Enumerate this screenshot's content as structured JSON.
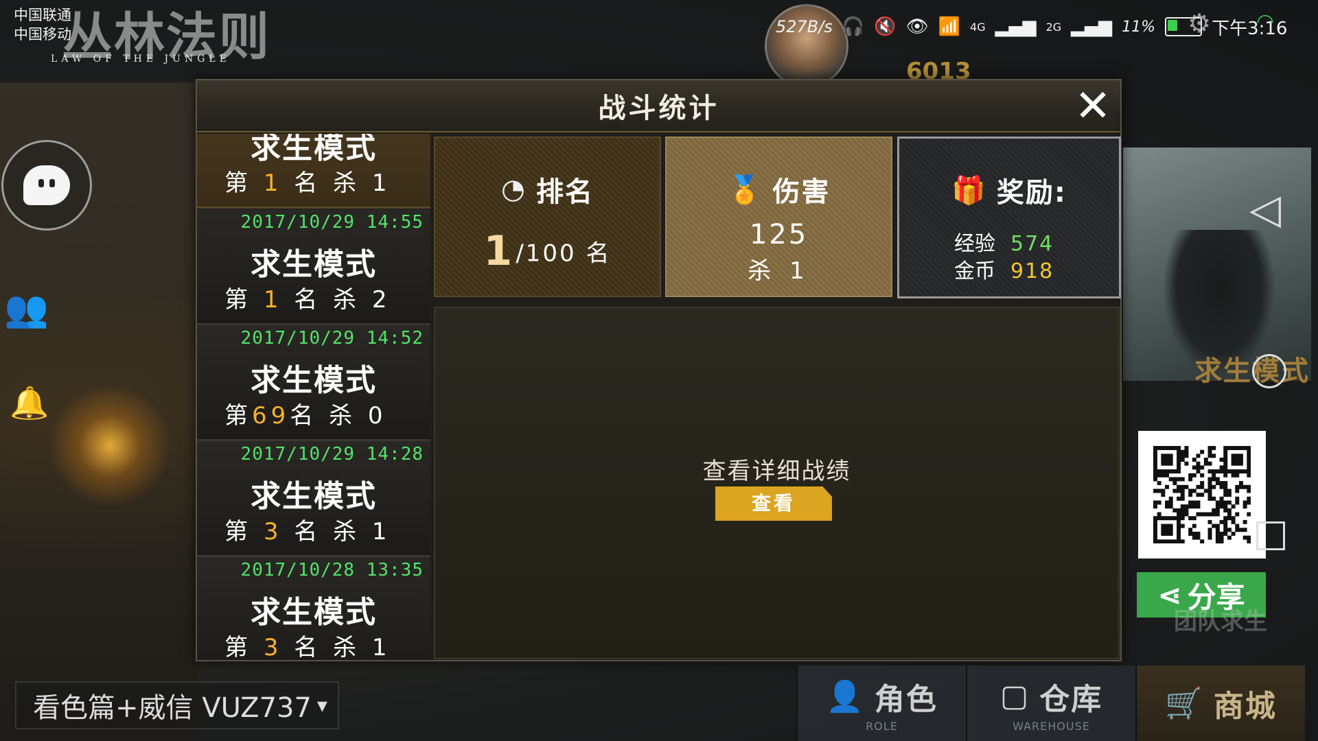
{
  "status": {
    "carrier_1": "中国联通",
    "carrier_2": "中国移动",
    "speed": "527B/s",
    "net1": "4G",
    "net2": "2G",
    "battery_pct": "11%",
    "time": "下午3:16"
  },
  "game": {
    "logo_title": "丛林法则",
    "logo_subtitle": "LAW OF THE JUNGLE",
    "gold_amount": "6013"
  },
  "modal": {
    "title": "战斗统计",
    "close_symbol": "✕"
  },
  "match_list": [
    {
      "date": "",
      "mode": "求生模式",
      "rank_prefix": "第",
      "rank": "1",
      "rank_suffix": "名",
      "kill_label": "杀",
      "kills": "1",
      "active": true
    },
    {
      "date": "2017/10/29 14:55",
      "mode": "求生模式",
      "rank_prefix": "第",
      "rank": "1",
      "rank_suffix": "名",
      "kill_label": "杀",
      "kills": "2",
      "active": false
    },
    {
      "date": "2017/10/29 14:52",
      "mode": "求生模式",
      "rank_prefix": "第",
      "rank": "69",
      "rank_suffix": "名",
      "kill_label": "杀",
      "kills": "0",
      "active": false
    },
    {
      "date": "2017/10/29 14:28",
      "mode": "求生模式",
      "rank_prefix": "第",
      "rank": "3",
      "rank_suffix": "名",
      "kill_label": "杀",
      "kills": "1",
      "active": false
    },
    {
      "date": "2017/10/28 13:35",
      "mode": "求生模式",
      "rank_prefix": "第",
      "rank": "3",
      "rank_suffix": "名",
      "kill_label": "杀",
      "kills": "1",
      "active": false
    }
  ],
  "stats": {
    "rank": {
      "label": "排名",
      "value": "1",
      "total": "/100 名",
      "icon": "ranking-icon"
    },
    "damage": {
      "label": "伤害",
      "value": "125",
      "kills": "杀 1",
      "icon": "medal-icon"
    },
    "reward": {
      "label": "奖励:",
      "exp_label": "经验",
      "exp_value": "574",
      "gold_label": "金币",
      "gold_value": "918",
      "icon": "gift-icon"
    }
  },
  "detail": {
    "label": "查看详细战绩",
    "button": "查看"
  },
  "right_panel": {
    "mode_label": "求生模式",
    "share_label": "分享",
    "team_label": "团队求生"
  },
  "chat": {
    "text": "看色篇+威信 VUZ737"
  },
  "tabs": [
    {
      "zh": "角色",
      "en": "ROLE",
      "icon": "role-icon"
    },
    {
      "zh": "仓库",
      "en": "WAREHOUSE",
      "icon": "warehouse-icon"
    },
    {
      "zh": "商城",
      "en": "",
      "icon": "cart-icon"
    }
  ],
  "colors": {
    "accent_gold": "#dba421",
    "rank_highlight": "#f5b22a",
    "date_green": "#52e36b",
    "exp_green": "#6ee060",
    "share_green": "#3aa84a"
  }
}
